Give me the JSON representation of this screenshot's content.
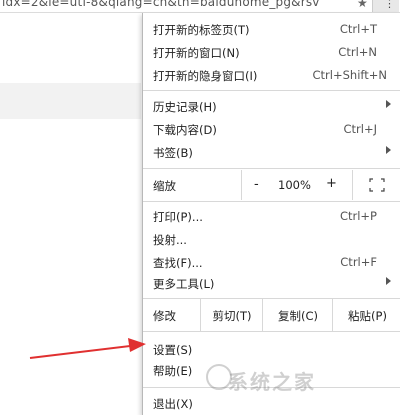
{
  "browser": {
    "url_fragment": "idx=2&ie=utf-8&qiang=ch&tn=baiduhome_pg&rsv",
    "star_icon": "star-icon",
    "menu_icon": "kebab-menu-icon"
  },
  "menu": {
    "new_tab": {
      "label": "打开新的标签页(T)",
      "shortcut": "Ctrl+T"
    },
    "new_window": {
      "label": "打开新的窗口(N)",
      "shortcut": "Ctrl+N"
    },
    "incognito": {
      "label": "打开新的隐身窗口(I)",
      "shortcut": "Ctrl+Shift+N"
    },
    "history": {
      "label": "历史记录(H)"
    },
    "downloads": {
      "label": "下载内容(D)",
      "shortcut": "Ctrl+J"
    },
    "bookmarks": {
      "label": "书签(B)"
    },
    "zoom": {
      "label": "缩放",
      "minus": "-",
      "value": "100%",
      "plus": "+"
    },
    "print": {
      "label": "打印(P)...",
      "shortcut": "Ctrl+P"
    },
    "cast": {
      "label": "投射..."
    },
    "find": {
      "label": "查找(F)...",
      "shortcut": "Ctrl+F"
    },
    "more_tools": {
      "label": "更多工具(L)"
    },
    "edit": {
      "label": "修改",
      "cut": "剪切(T)",
      "copy": "复制(C)",
      "paste": "粘贴(P)"
    },
    "settings": {
      "label": "设置(S)"
    },
    "help": {
      "label": "帮助(E)"
    },
    "exit": {
      "label": "退出(X)"
    }
  },
  "watermark": {
    "text": "系统之家"
  },
  "colors": {
    "annotation_arrow": "#e03030"
  }
}
